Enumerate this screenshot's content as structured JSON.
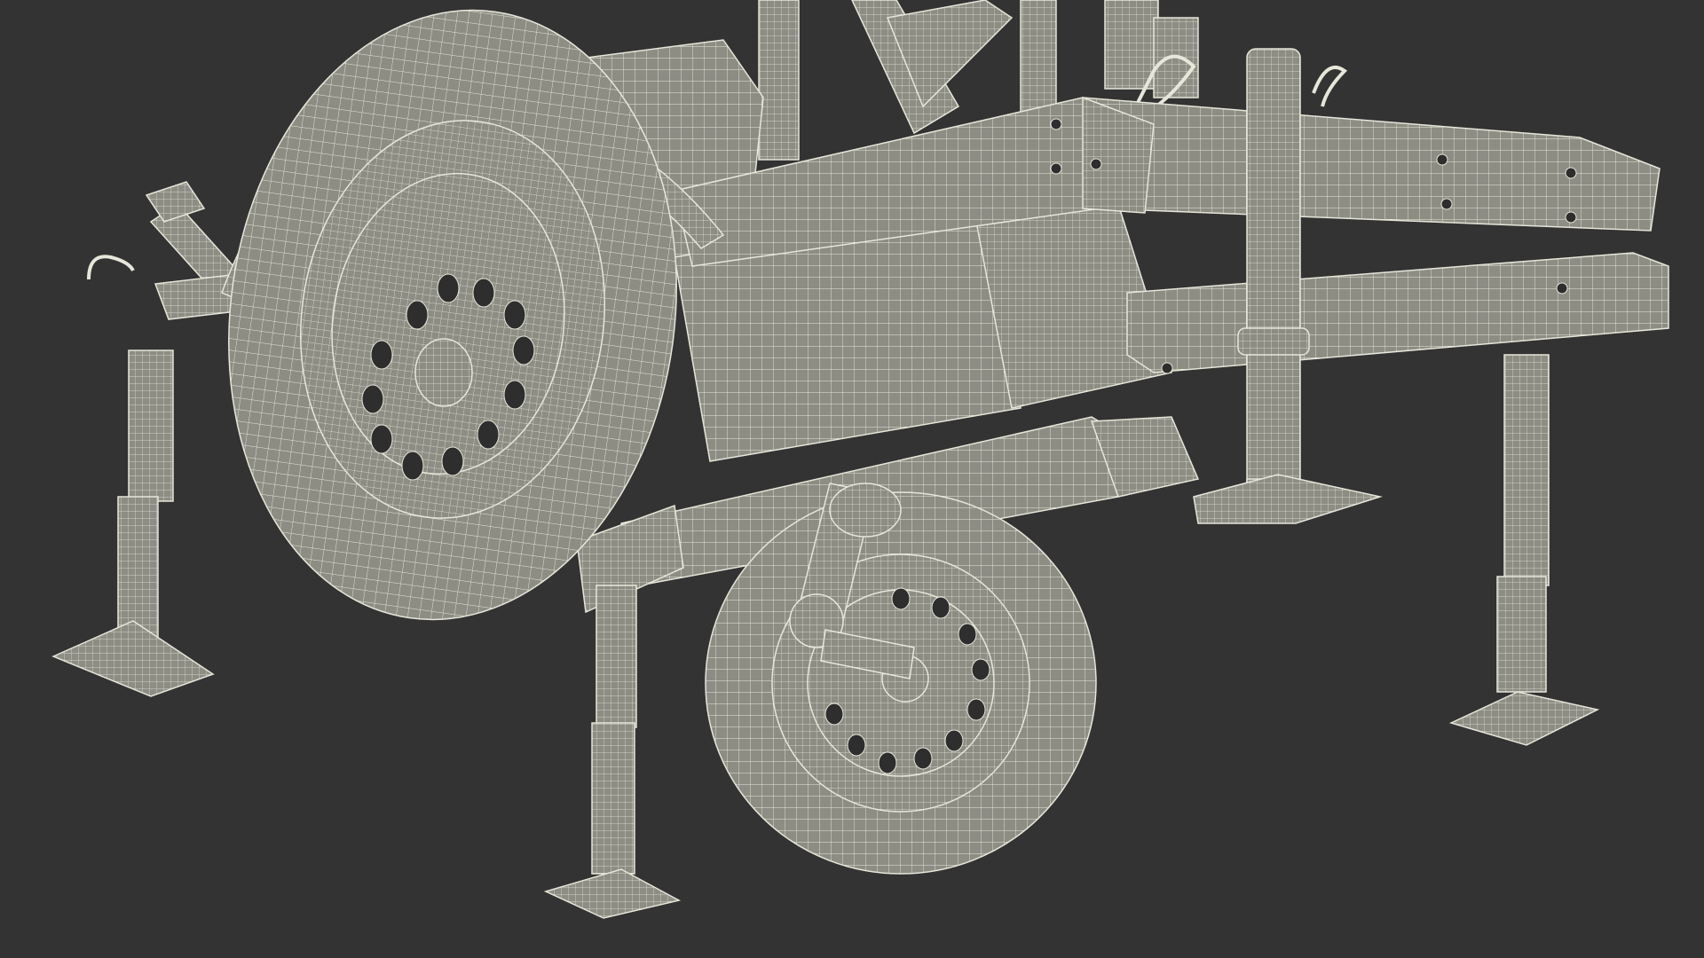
{
  "scene": {
    "background_color": "#333333",
    "mesh_fill_color": "#8d8d84",
    "mesh_shadow_color": "#6f6f68",
    "wire_color": "#e6e6da",
    "hole_color": "#2e2e2e"
  }
}
